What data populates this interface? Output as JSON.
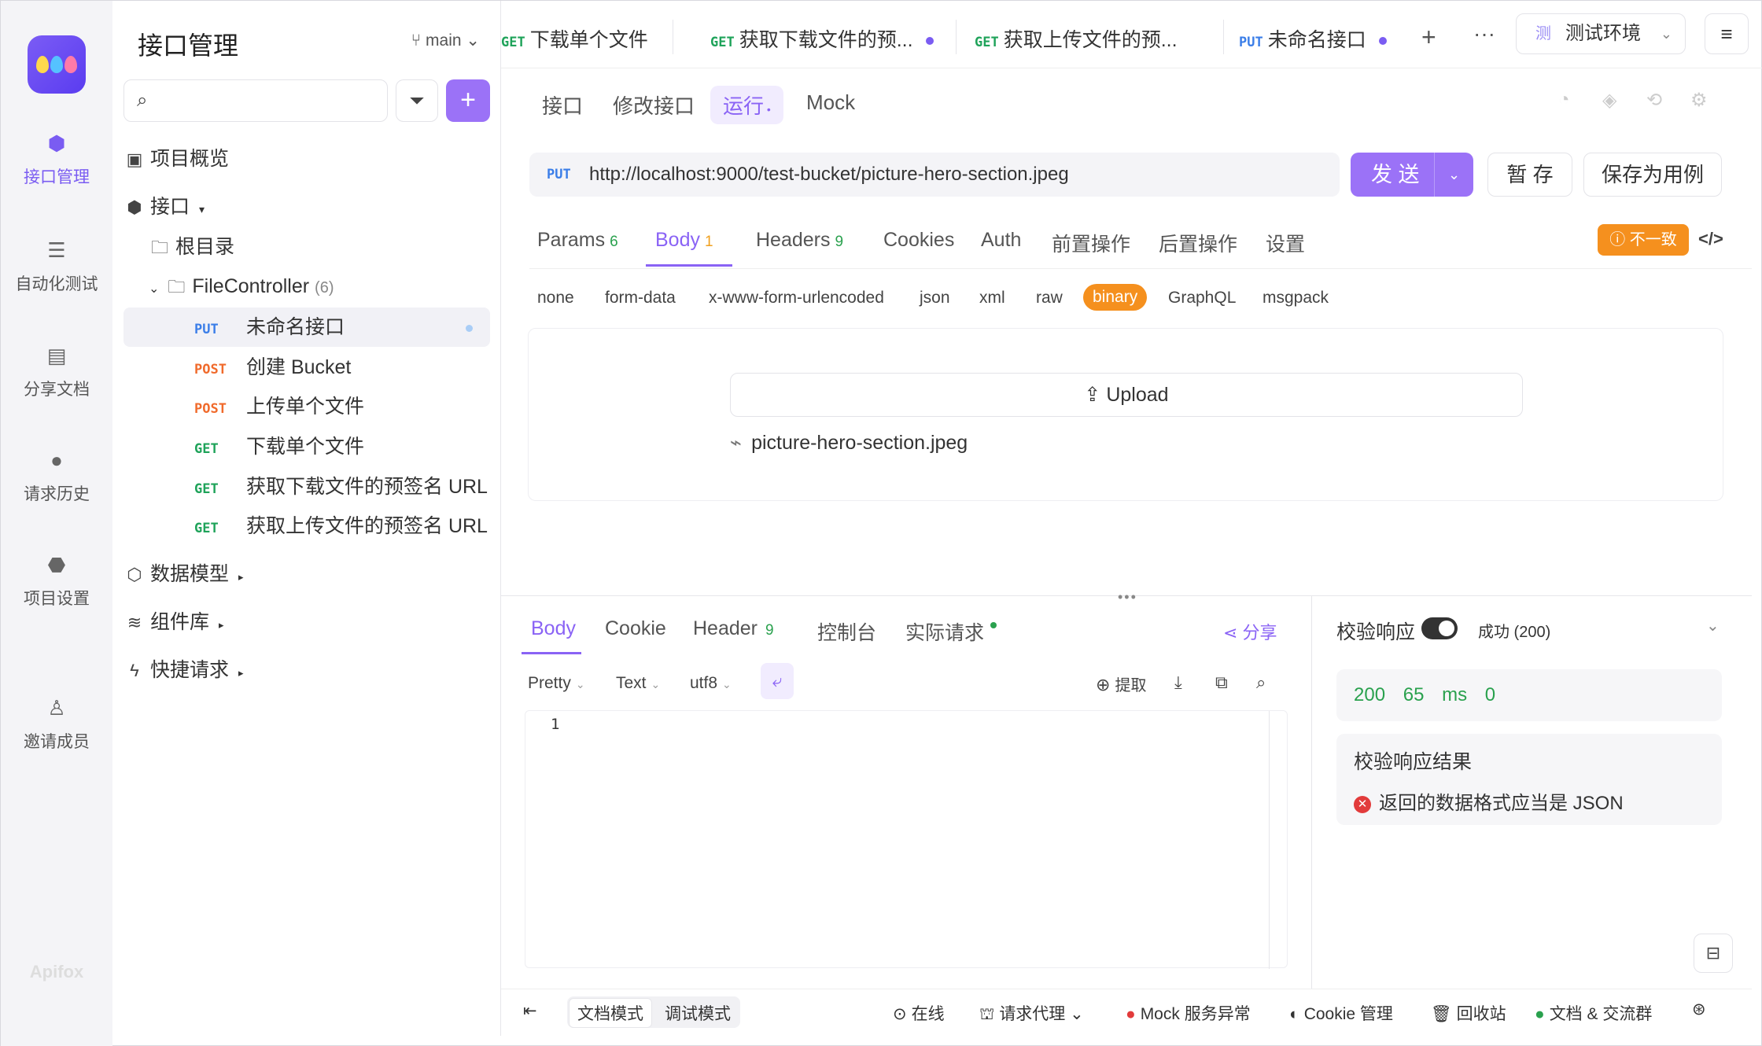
{
  "app": {
    "brand": "Apifox",
    "rail": [
      {
        "label": "接口管理",
        "icon": "api-icon"
      },
      {
        "label": "自动化测试",
        "icon": "automation-icon"
      },
      {
        "label": "分享文档",
        "icon": "book-icon"
      },
      {
        "label": "请求历史",
        "icon": "clock-icon"
      },
      {
        "label": "项目设置",
        "icon": "settings-icon"
      },
      {
        "label": "邀请成员",
        "icon": "user-add-icon"
      }
    ]
  },
  "sidebar": {
    "title": "接口管理",
    "branch": "main",
    "search_placeholder": "",
    "overview": "项目概览",
    "apis": "接口",
    "root": "根目录",
    "folder": "FileController",
    "folder_count": "(6)",
    "items": [
      {
        "method": "PUT",
        "name": "未命名接口"
      },
      {
        "method": "POST",
        "name": "创建 Bucket"
      },
      {
        "method": "POST",
        "name": "上传单个文件"
      },
      {
        "method": "GET",
        "name": "下载单个文件"
      },
      {
        "method": "GET",
        "name": "获取下载文件的预签名 URL"
      },
      {
        "method": "GET",
        "name": "获取上传文件的预签名 URL"
      }
    ],
    "data_models": "数据模型",
    "components": "组件库",
    "quick_requests": "快捷请求"
  },
  "tabs": [
    {
      "method": "GET",
      "name": "下载单个文件"
    },
    {
      "method": "GET",
      "name": "获取下载文件的预..."
    },
    {
      "method": "GET",
      "name": "获取上传文件的预..."
    },
    {
      "method": "PUT",
      "name": "未命名接口"
    }
  ],
  "env": "测试环境",
  "subtabs": [
    "接口",
    "修改接口",
    "运行",
    "Mock"
  ],
  "request": {
    "method": "PUT",
    "url": "http://localhost:9000/test-bucket/picture-hero-section.jpeg",
    "send": "发 送",
    "save": "暂 存",
    "save_case": "保存为用例"
  },
  "param_tabs": [
    {
      "label": "Params",
      "count": "6"
    },
    {
      "label": "Body",
      "count": "1"
    },
    {
      "label": "Headers",
      "count": "9"
    },
    {
      "label": "Cookies",
      "count": ""
    },
    {
      "label": "Auth",
      "count": ""
    },
    {
      "label": "前置操作",
      "count": ""
    },
    {
      "label": "后置操作",
      "count": ""
    },
    {
      "label": "设置",
      "count": ""
    }
  ],
  "mismatch": "不一致",
  "body_types": [
    "none",
    "form-data",
    "x-www-form-urlencoded",
    "json",
    "xml",
    "raw",
    "binary",
    "GraphQL",
    "msgpack"
  ],
  "body": {
    "upload": "Upload",
    "file": "picture-hero-section.jpeg"
  },
  "response": {
    "tabs": [
      {
        "label": "Body",
        "count": ""
      },
      {
        "label": "Cookie",
        "count": ""
      },
      {
        "label": "Header",
        "count": "9"
      },
      {
        "label": "控制台",
        "count": ""
      },
      {
        "label": "实际请求",
        "count": ""
      }
    ],
    "share": "分享",
    "format": "Pretty",
    "type": "Text",
    "encoding": "utf8",
    "extract": "提取",
    "line": "1"
  },
  "validation": {
    "title": "校验响应",
    "status": "成功 (200)",
    "code": "200",
    "time": "65 ms",
    "size": "0",
    "result_title": "校验响应结果",
    "error": "返回的数据格式应当是 JSON"
  },
  "footer": {
    "doc_mode": "文档模式",
    "debug_mode": "调试模式",
    "online": "在线",
    "proxy": "请求代理",
    "mock": "Mock 服务异常",
    "cookie": "Cookie 管理",
    "trash": "回收站",
    "community": "文档 & 交流群"
  },
  "colors": {
    "accent": "#8a63f5",
    "orange": "#f5901e",
    "green": "#2aa14e",
    "put": "#3b7ee8",
    "post": "#f06a2b",
    "get": "#1fa35a"
  }
}
